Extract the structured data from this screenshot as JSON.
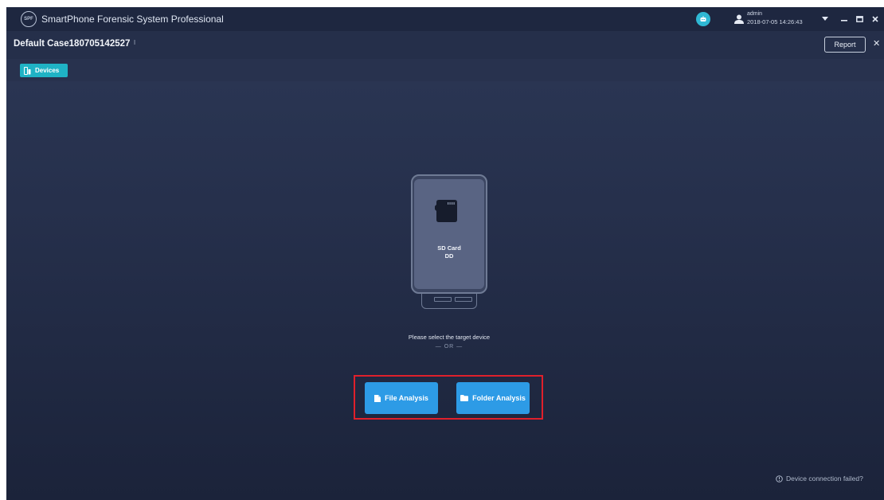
{
  "titlebar": {
    "app_title": "SmartPhone Forensic System Professional",
    "logo_text": "SPF",
    "user_name": "admin",
    "user_time": "2018-07-05 14:26:43"
  },
  "case": {
    "title": "Default Case180705142527",
    "report_label": "Report"
  },
  "tabs": {
    "devices_label": "Devices"
  },
  "device": {
    "label_line1": "SD Card",
    "label_line2": "DD"
  },
  "main": {
    "prompt": "Please select the target device",
    "or_text": "— OR —",
    "file_analysis_label": "File Analysis",
    "folder_analysis_label": "Folder Analysis"
  },
  "footer": {
    "connection_failed": "Device connection failed?"
  },
  "colors": {
    "accent": "#2d9be6",
    "tab_accent": "#1fb3c5",
    "highlight": "#e0202b"
  }
}
